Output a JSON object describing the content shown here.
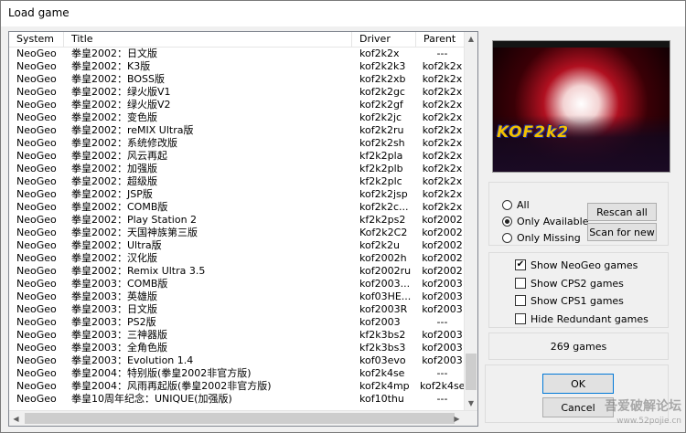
{
  "window": {
    "title": "Load game"
  },
  "columns": {
    "system": "System",
    "title": "Title",
    "driver": "Driver",
    "parent": "Parent"
  },
  "games": [
    {
      "system": "NeoGeo",
      "title": "拳皇2002：日文版",
      "driver": "kof2k2x",
      "parent": "---"
    },
    {
      "system": "NeoGeo",
      "title": "拳皇2002：K3版",
      "driver": "kof2k2k3",
      "parent": "kof2k2x"
    },
    {
      "system": "NeoGeo",
      "title": "拳皇2002：BOSS版",
      "driver": "kof2k2xb",
      "parent": "kof2k2x"
    },
    {
      "system": "NeoGeo",
      "title": "拳皇2002：绿火版V1",
      "driver": "kof2k2gc",
      "parent": "kof2k2x"
    },
    {
      "system": "NeoGeo",
      "title": "拳皇2002：绿火版V2",
      "driver": "kof2k2gf",
      "parent": "kof2k2x"
    },
    {
      "system": "NeoGeo",
      "title": "拳皇2002：变色版",
      "driver": "kof2k2jc",
      "parent": "kof2k2x"
    },
    {
      "system": "NeoGeo",
      "title": "拳皇2002：reMIX Ultra版",
      "driver": "kof2k2ru",
      "parent": "kof2k2x"
    },
    {
      "system": "NeoGeo",
      "title": "拳皇2002：系统修改版",
      "driver": "kof2k2sh",
      "parent": "kof2k2x"
    },
    {
      "system": "NeoGeo",
      "title": "拳皇2002：风云再起",
      "driver": "kf2k2pla",
      "parent": "kof2k2x"
    },
    {
      "system": "NeoGeo",
      "title": "拳皇2002：加强版",
      "driver": "kf2k2plb",
      "parent": "kof2k2x"
    },
    {
      "system": "NeoGeo",
      "title": "拳皇2002：超级版",
      "driver": "kf2k2plc",
      "parent": "kof2k2x"
    },
    {
      "system": "NeoGeo",
      "title": "拳皇2002：JSP版",
      "driver": "kof2k2jsp",
      "parent": "kof2k2x"
    },
    {
      "system": "NeoGeo",
      "title": "拳皇2002：COMB版",
      "driver": "kof2k2c...",
      "parent": "kof2k2x"
    },
    {
      "system": "NeoGeo",
      "title": "拳皇2002：Play Station 2",
      "driver": "kf2k2ps2",
      "parent": "kof2002"
    },
    {
      "system": "NeoGeo",
      "title": "拳皇2002：天国神族第三版",
      "driver": "Kof2k2C2",
      "parent": "kof2002"
    },
    {
      "system": "NeoGeo",
      "title": "拳皇2002：Ultra版",
      "driver": "kof2k2u",
      "parent": "kof2002"
    },
    {
      "system": "NeoGeo",
      "title": "拳皇2002：汉化版",
      "driver": "kof2002h",
      "parent": "kof2002"
    },
    {
      "system": "NeoGeo",
      "title": "拳皇2002：Remix Ultra 3.5",
      "driver": "kof2002ru",
      "parent": "kof2002"
    },
    {
      "system": "NeoGeo",
      "title": "拳皇2003：COMB版",
      "driver": "kof2003...",
      "parent": "kof2003"
    },
    {
      "system": "NeoGeo",
      "title": "拳皇2003：英雄版",
      "driver": "kof03HE...",
      "parent": "kof2003"
    },
    {
      "system": "NeoGeo",
      "title": "拳皇2003：日文版",
      "driver": "kof2003R",
      "parent": "kof2003"
    },
    {
      "system": "NeoGeo",
      "title": "拳皇2003：PS2版",
      "driver": "kof2003",
      "parent": "---"
    },
    {
      "system": "NeoGeo",
      "title": "拳皇2003：三神器版",
      "driver": "kf2k3bs2",
      "parent": "kof2003"
    },
    {
      "system": "NeoGeo",
      "title": "拳皇2003：全角色版",
      "driver": "kf2k3bs3",
      "parent": "kof2003"
    },
    {
      "system": "NeoGeo",
      "title": "拳皇2003：Evolution 1.4",
      "driver": "kof03evo",
      "parent": "kof2003"
    },
    {
      "system": "NeoGeo",
      "title": "拳皇2004：特别版(拳皇2002非官方版)",
      "driver": "kof2k4se",
      "parent": "---"
    },
    {
      "system": "NeoGeo",
      "title": "拳皇2004：风雨再起版(拳皇2002非官方版)",
      "driver": "kof2k4mp",
      "parent": "kof2k4se"
    },
    {
      "system": "NeoGeo",
      "title": "拳皇10周年纪念：UNIQUE(加强版)",
      "driver": "kof10thu",
      "parent": "---"
    }
  ],
  "preview": {
    "banner_text": "· · ·",
    "logo_text": "KOF2k2"
  },
  "filter": {
    "options": [
      {
        "label": "All",
        "selected": false
      },
      {
        "label": "Only Available",
        "selected": true
      },
      {
        "label": "Only Missing",
        "selected": false
      }
    ],
    "rescan_label": "Rescan all",
    "scan_new_label": "Scan for new"
  },
  "options": [
    {
      "label": "Show NeoGeo games",
      "checked": true
    },
    {
      "label": "Show CPS2 games",
      "checked": false
    },
    {
      "label": "Show CPS1 games",
      "checked": false
    },
    {
      "label": "Hide Redundant games",
      "checked": false
    }
  ],
  "count_text": "269 games",
  "buttons": {
    "ok": "OK",
    "cancel": "Cancel"
  },
  "watermark": {
    "text": "吾爱破解论坛",
    "url": "www.52pojie.cn"
  }
}
